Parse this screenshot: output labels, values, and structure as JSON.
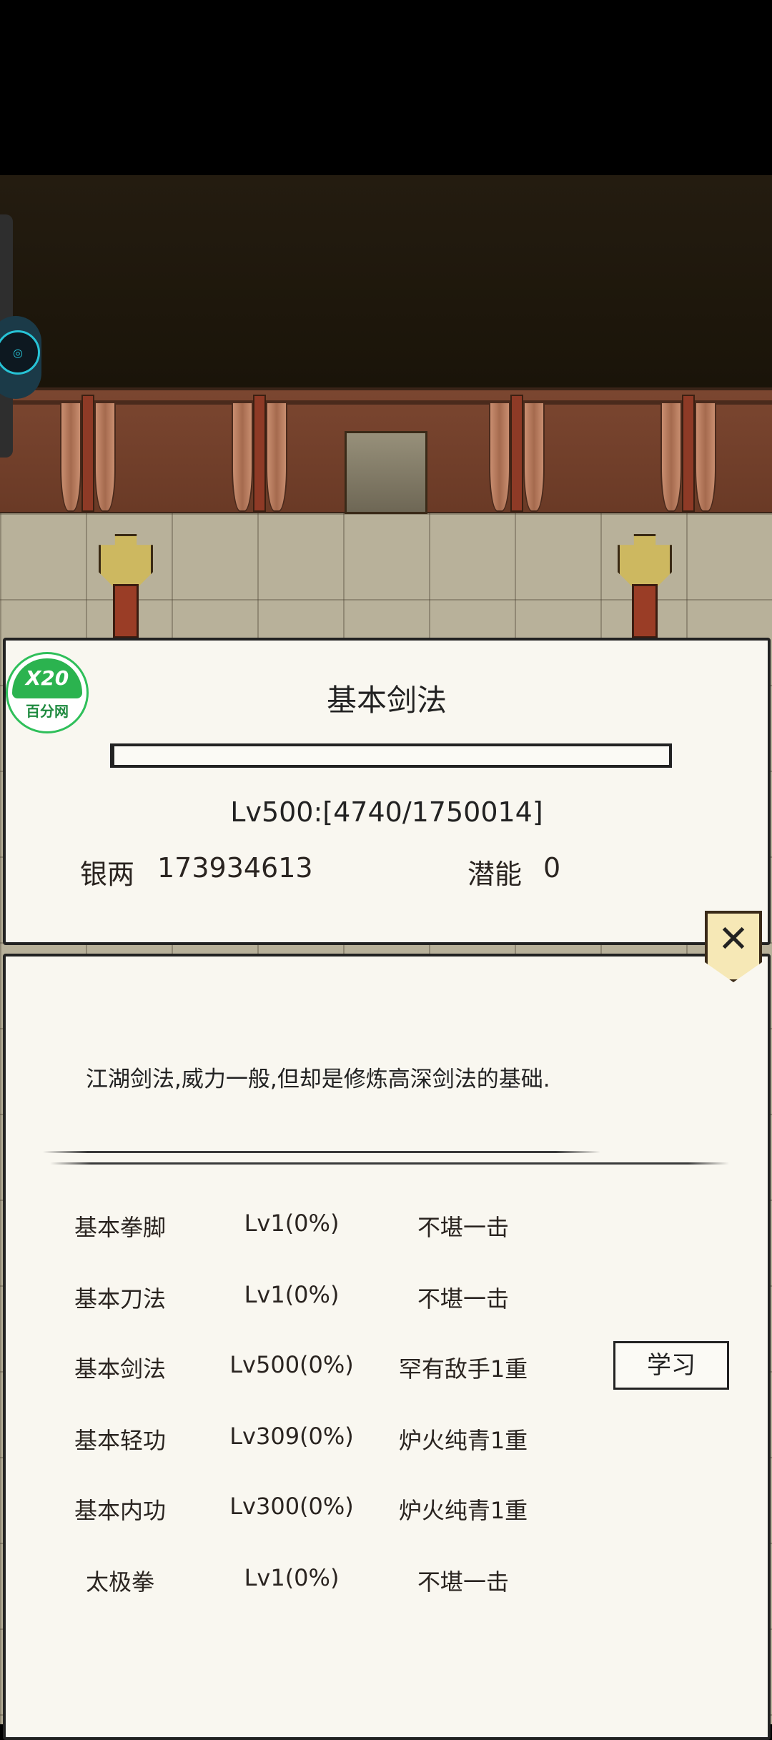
{
  "skill_panel": {
    "title": "基本剑法",
    "progress_fraction": 0.0027,
    "level_text": "Lv500:[4740/1750014]",
    "silver_label": "银两",
    "silver_value": "173934613",
    "potential_label": "潜能",
    "potential_value": "0"
  },
  "detail_panel": {
    "description": "江湖剑法,威力一般,但却是修炼高深剑法的基础.",
    "learn_button": "学习",
    "close_icon": "close-icon",
    "skills": [
      {
        "name": "基本拳脚",
        "level": "Lv1(0%)",
        "rank": "不堪一击"
      },
      {
        "name": "基本刀法",
        "level": "Lv1(0%)",
        "rank": "不堪一击"
      },
      {
        "name": "基本剑法",
        "level": "Lv500(0%)",
        "rank": "罕有敌手1重"
      },
      {
        "name": "基本轻功",
        "level": "Lv309(0%)",
        "rank": "炉火纯青1重"
      },
      {
        "name": "基本内功",
        "level": "Lv300(0%)",
        "rank": "炉火纯青1重"
      },
      {
        "name": "太极拳",
        "level": "Lv1(0%)",
        "rank": "不堪一击"
      }
    ]
  },
  "watermark": {
    "top": "X20",
    "bottom": "百分网"
  },
  "colors": {
    "panel_bg": "#f9f7f0",
    "close_bg": "#f6e8b6",
    "wall": "#7b4630",
    "floor": "#b8b19a"
  }
}
